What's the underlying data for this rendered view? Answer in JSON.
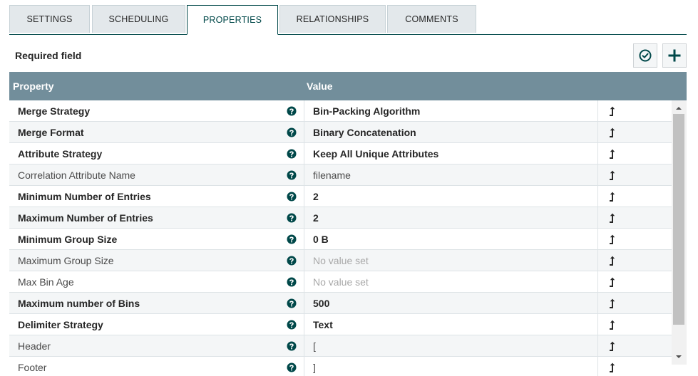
{
  "tabs": [
    {
      "label": "SETTINGS"
    },
    {
      "label": "SCHEDULING"
    },
    {
      "label": "PROPERTIES"
    },
    {
      "label": "RELATIONSHIPS"
    },
    {
      "label": "COMMENTS"
    }
  ],
  "header": {
    "required_label": "Required field"
  },
  "table": {
    "col_property": "Property",
    "col_value": "Value",
    "rows": [
      {
        "name": "Merge Strategy",
        "value": "Bin-Packing Algorithm"
      },
      {
        "name": "Merge Format",
        "value": "Binary Concatenation"
      },
      {
        "name": "Attribute Strategy",
        "value": "Keep All Unique Attributes"
      },
      {
        "name": "Correlation Attribute Name",
        "value": "filename"
      },
      {
        "name": "Minimum Number of Entries",
        "value": "2"
      },
      {
        "name": "Maximum Number of Entries",
        "value": "2"
      },
      {
        "name": "Minimum Group Size",
        "value": "0 B"
      },
      {
        "name": "Maximum Group Size",
        "value": "No value set"
      },
      {
        "name": "Max Bin Age",
        "value": "No value set"
      },
      {
        "name": "Maximum number of Bins",
        "value": "500"
      },
      {
        "name": "Delimiter Strategy",
        "value": "Text"
      },
      {
        "name": "Header",
        "value": "["
      },
      {
        "name": "Footer",
        "value": "]"
      }
    ]
  },
  "colors": {
    "accent": "#004849",
    "table_header_bg": "#728e9b",
    "tab_bg": "#e3e8eb",
    "unset_text": "#a8a8a8"
  },
  "icons": {
    "verify": "check-circle-icon",
    "add": "plus-icon",
    "help": "question-circle-icon",
    "action": "go-to-arrow-icon"
  }
}
